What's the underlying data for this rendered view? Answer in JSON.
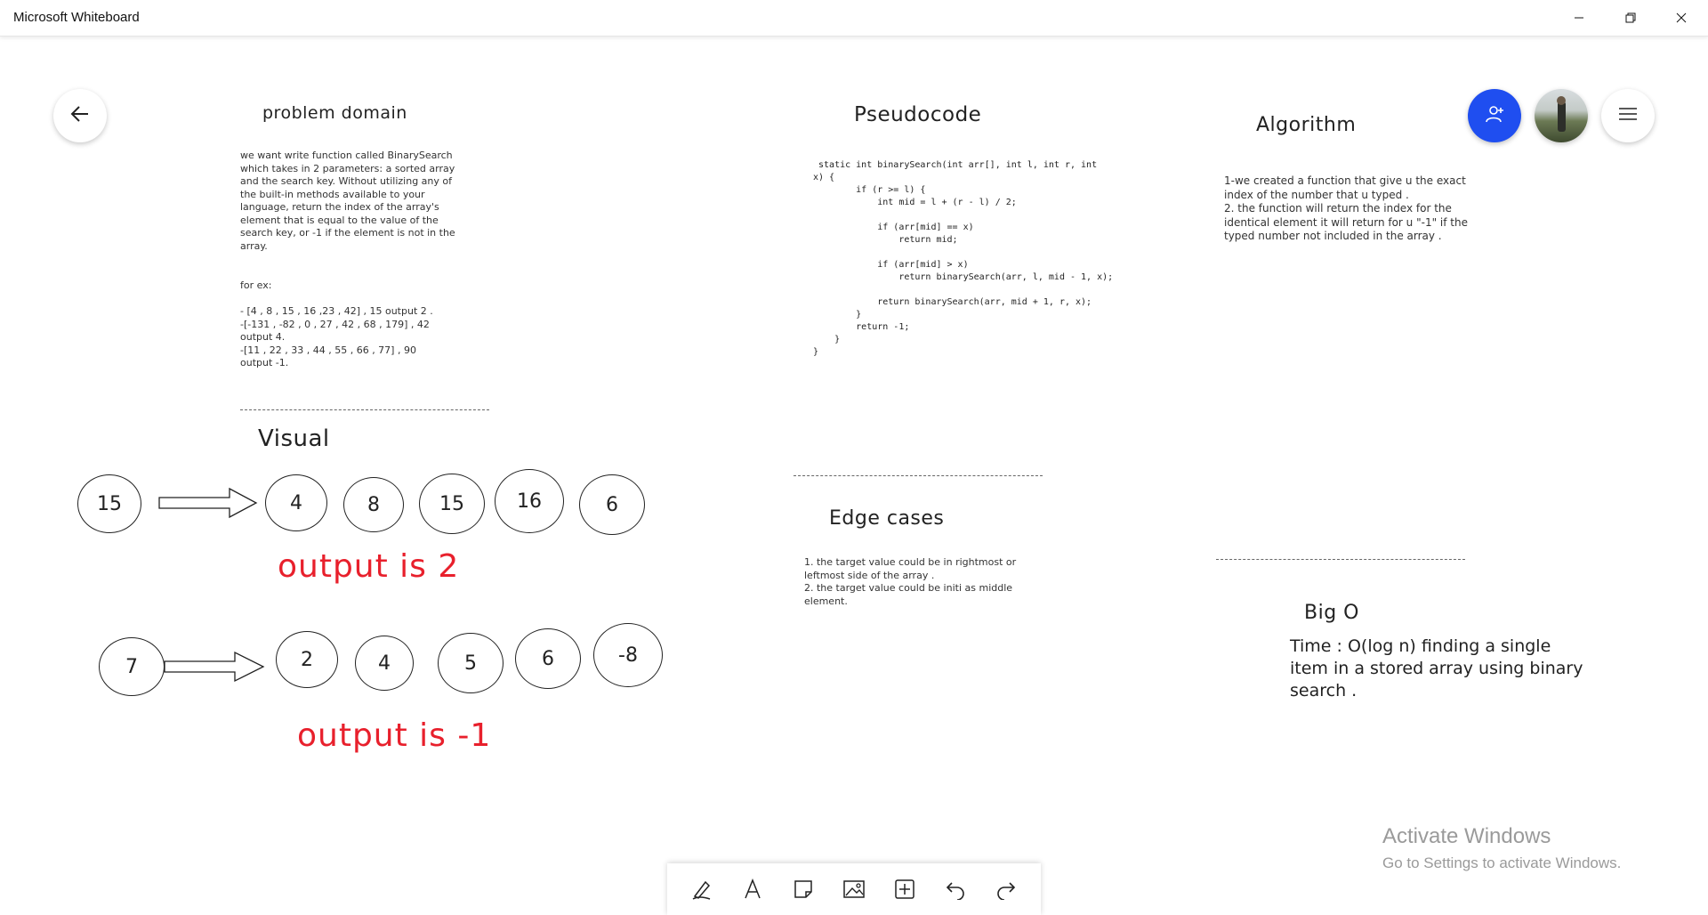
{
  "window": {
    "title": "Microsoft Whiteboard",
    "controls": [
      "minimize-icon",
      "restore-icon",
      "close-icon"
    ]
  },
  "nav": {
    "back_icon": "back-arrow-icon",
    "invite_icon": "invite-person-icon",
    "menu_icon": "hamburger-menu-icon",
    "accent": "#1f4ef0"
  },
  "board": {
    "problem_domain": {
      "title": "problem domain",
      "text": "we want write function called BinarySearch\nwhich takes in 2 parameters: a sorted array\nand the search key. Without utilizing any of\nthe built-in methods available to your\nlanguage, return the index of the array's\nelement that is equal to the value of the\nsearch key, or -1 if the element is not in the\narray.",
      "examples": "for ex:\n\n- [4 , 8 , 15 , 16 ,23 , 42] , 15  output 2 .\n-[-131 , -82 , 0 , 27 , 42 , 68 , 179] , 42\noutput 4.\n-[11 , 22 , 33 , 44 , 55 , 66 , 77] , 90\noutput -1."
    },
    "pseudocode": {
      "title": "Pseudocode",
      "code": " static int binarySearch(int arr[], int l, int r, int\nx) {\n        if (r >= l) {\n            int mid = l + (r - l) / 2;\n\n            if (arr[mid] == x)\n                return mid;\n\n            if (arr[mid] > x)\n                return binarySearch(arr, l, mid - 1, x);\n\n            return binarySearch(arr, mid + 1, r, x);\n        }\n        return -1;\n    }\n}"
    },
    "algorithm": {
      "title": "Algorithm",
      "text": "1-we created a function that give u the exact\nindex of the number that u typed .\n2. the function will return the index for the\nidentical element it will return for u \"-1\" if the\ntyped number not included in the array ."
    },
    "visual": {
      "title": "Visual",
      "example1": {
        "key": "15",
        "items": [
          "4",
          "8",
          "15",
          "16",
          "6"
        ],
        "output": "output is 2"
      },
      "example2": {
        "key": "7",
        "items": [
          "2",
          "4",
          "5",
          "6",
          "-8"
        ],
        "output": "output is -1"
      }
    },
    "edge_cases": {
      "title": "Edge cases",
      "text": "1. the target value could be in rightmost or\nleftmost side of the array .\n2. the target value could be initi as middle\nelement."
    },
    "big_o": {
      "title": "Big O",
      "text": "Time :  O(log n) finding a single\nitem in a stored array using binary\nsearch ."
    }
  },
  "toolbar": {
    "tools": [
      "pen-icon",
      "text-icon",
      "sticky-note-icon",
      "image-icon",
      "add-icon",
      "undo-icon",
      "redo-icon"
    ]
  },
  "watermark": {
    "line1": "Activate Windows",
    "line2": "Go to Settings to activate Windows."
  }
}
